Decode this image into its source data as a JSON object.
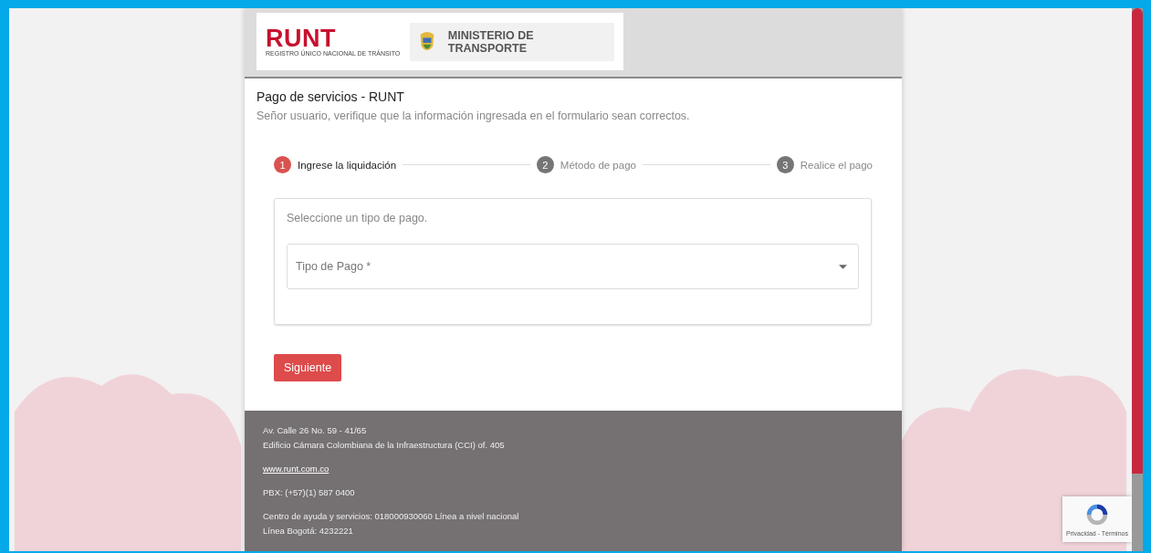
{
  "header": {
    "logo_text": "RUNT",
    "logo_subtitle": "REGISTRO ÚNICO NACIONAL DE TRÁNSITO",
    "ministry": "MINISTERIO DE TRANSPORTE"
  },
  "card": {
    "title": "Pago de servicios - RUNT",
    "subtitle": "Señor usuario, verifique que la información ingresada en el formulario sean correctos."
  },
  "steps": [
    {
      "number": "1",
      "label": "Ingrese la liquidación",
      "active": true
    },
    {
      "number": "2",
      "label": "Método de pago",
      "active": false
    },
    {
      "number": "3",
      "label": "Realice el pago",
      "active": false
    }
  ],
  "form": {
    "prompt": "Seleccione un tipo de pago.",
    "select_placeholder": "Tipo de Pago *"
  },
  "next_button": "Siguiente",
  "footer": {
    "address_1": "Av. Calle 26 No. 59 - 41/65",
    "address_2": "Edificio Cámara Colombiana de la Infraestructura (CCI) of. 405",
    "link": "www.runt.com.co",
    "pbx": "PBX: (+57)(1) 587 0400",
    "help_1": "Centro de ayuda y servicios: 018000930060 Línea a nivel nacional",
    "help_2": "Línea Bogotá: 4232221"
  },
  "recaptcha": {
    "links": "Privacidad - Términos"
  }
}
